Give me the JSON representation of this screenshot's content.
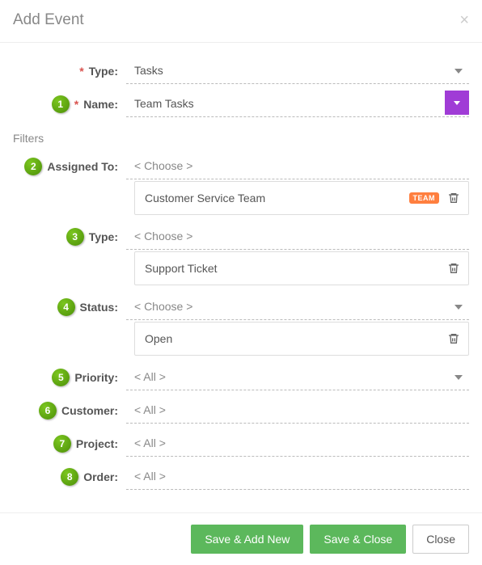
{
  "header": {
    "title": "Add Event",
    "close_symbol": "×"
  },
  "form": {
    "type": {
      "label": "Type:",
      "value": "Tasks"
    },
    "name": {
      "label": "Name:",
      "value": "Team Tasks",
      "badge": "1"
    }
  },
  "filters": {
    "section_label": "Filters",
    "assigned_to": {
      "badge": "2",
      "label": "Assigned To:",
      "placeholder": "< Choose >",
      "chip_text": "Customer Service Team",
      "chip_badge": "TEAM"
    },
    "type": {
      "badge": "3",
      "label": "Type:",
      "placeholder": "< Choose >",
      "chip_text": "Support Ticket"
    },
    "status": {
      "badge": "4",
      "label": "Status:",
      "placeholder": "< Choose >",
      "chip_text": "Open"
    },
    "priority": {
      "badge": "5",
      "label": "Priority:",
      "value": "< All >"
    },
    "customer": {
      "badge": "6",
      "label": "Customer:",
      "value": "< All >"
    },
    "project": {
      "badge": "7",
      "label": "Project:",
      "value": "< All >"
    },
    "order": {
      "badge": "8",
      "label": "Order:",
      "value": "< All >"
    }
  },
  "footer": {
    "save_add_new": "Save & Add New",
    "save_close": "Save & Close",
    "close": "Close"
  }
}
